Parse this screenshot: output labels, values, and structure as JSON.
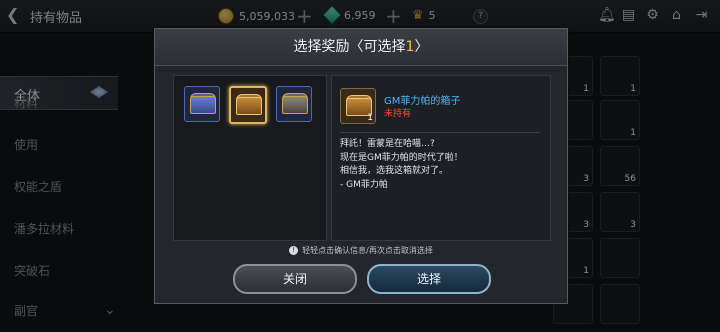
{
  "topbar": {
    "title": "持有物品",
    "gold": "5,059,033",
    "gems": "6,959",
    "crowns": "5",
    "help": "?"
  },
  "sidebar": {
    "items": [
      {
        "label": "全体",
        "active": true
      },
      {
        "label": "材料"
      },
      {
        "label": "使用"
      },
      {
        "label": "权能之盾"
      },
      {
        "label": "潘多拉材料"
      },
      {
        "label": "突破石"
      },
      {
        "label": "副官"
      }
    ]
  },
  "inventory_counts": [
    "1",
    "1",
    "1",
    "3",
    "56",
    "3",
    "3",
    "1"
  ],
  "dialog": {
    "title_prefix": "选择奖励〈可选择",
    "title_num": "1",
    "title_suffix": "〉",
    "item": {
      "count": "1",
      "name": "GM菲力帕的箱子",
      "status": "未持有"
    },
    "description": [
      "拜託！雷蒙是在哈喵…?",
      "现在是GM菲力帕的时代了啦！",
      "相信我，选我这箱就对了。",
      "- GM菲力帕"
    ],
    "hint": "轻轻点击确认信息/再次点击取消选择",
    "buttons": {
      "close": "关闭",
      "confirm": "选择"
    }
  },
  "colors": {
    "accent_gold": "#f1c040",
    "item_name": "#4fb6ff",
    "status_red": "#ff4a3a"
  }
}
